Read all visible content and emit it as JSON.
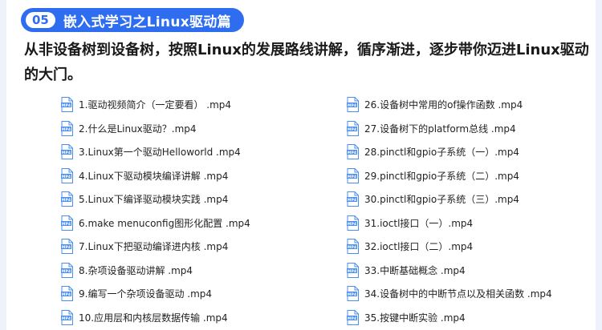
{
  "header": {
    "section_number": "05",
    "title": "嵌入式学习之Linux驱动篇"
  },
  "intro": "从非设备树到设备树，按照Linux的发展路线讲解，循序渐进，逐步带你迈进Linux驱动的大门。",
  "icon": "mp4-file-icon",
  "colors": {
    "accent": "#2f6df0",
    "icon_blue": "#4a8ef0"
  },
  "files_left": [
    "1.驱动视频简介（一定要看） .mp4",
    "2.什么是Linux驱动？.mp4",
    "3.Linux第一个驱动Helloworld .mp4",
    "4.Linux下驱动模块编译讲解 .mp4",
    "5.Linux下编译驱动模块实践 .mp4",
    "6.make menuconfig图形化配置 .mp4",
    "7.Linux下把驱动编译进内核 .mp4",
    "8.杂项设备驱动讲解 .mp4",
    "9.编写一个杂项设备驱动 .mp4",
    "10.应用层和内核层数据传输 .mp4"
  ],
  "files_right": [
    "26.设备树中常用的of操作函数 .mp4",
    "27.设备树下的platform总线 .mp4",
    "28.pinctl和gpio子系统（一）.mp4",
    "29.pinctl和gpio子系统（二）.mp4",
    "30.pinctl和gpio子系统（三）.mp4",
    "31.ioctl接口（一）.mp4",
    "32.ioctl接口（二）.mp4",
    "33.中断基础概念 .mp4",
    "34.设备树中的中断节点以及相关函数 .mp4",
    "35.按键中断实验 .mp4"
  ]
}
